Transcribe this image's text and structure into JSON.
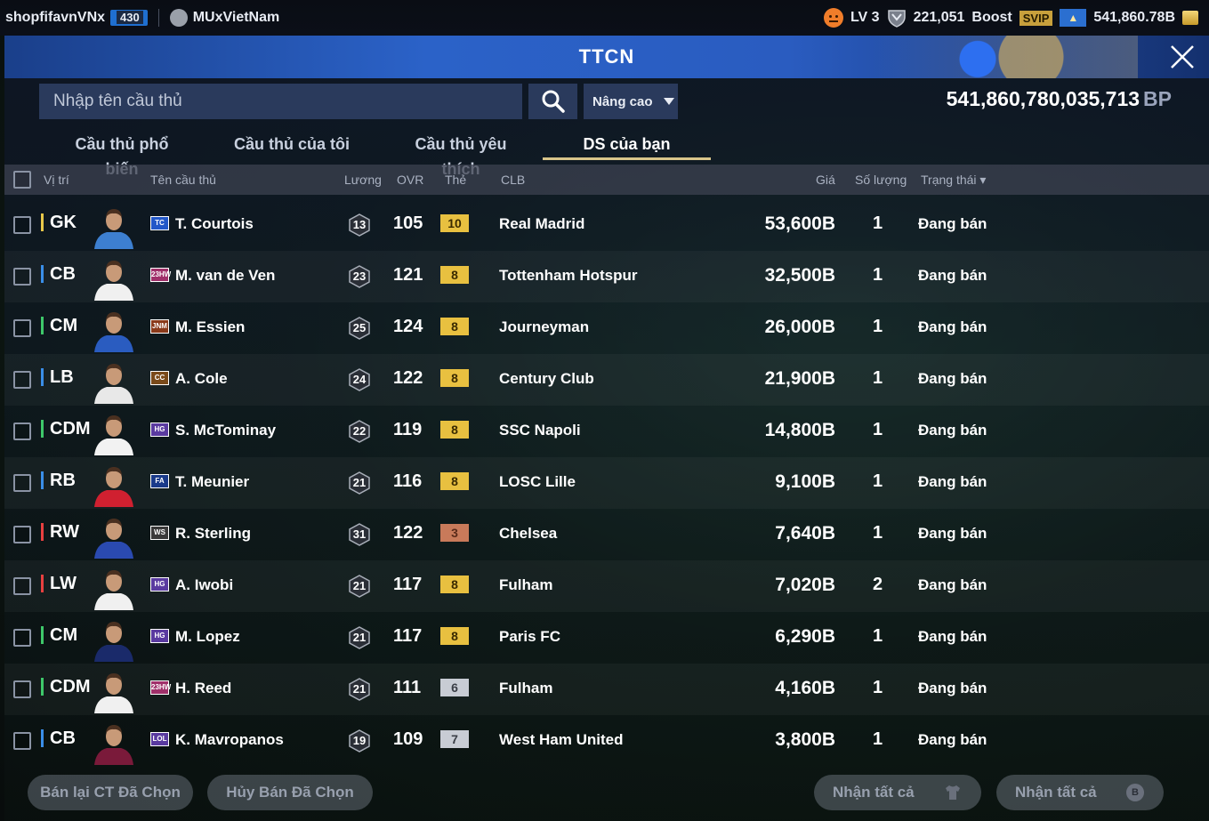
{
  "topbar": {
    "username": "shopfifavnVNx",
    "user_level": "430",
    "team_name": "MUxVietNam",
    "level_text": "LV 3",
    "shield_value": "221,051",
    "boost_label": "Boost",
    "svip_label": "SVIP",
    "coin_balance": "541,860.78B"
  },
  "window": {
    "title": "TTCN"
  },
  "search": {
    "placeholder": "Nhập tên cầu thủ",
    "advanced_label": "Nâng cao",
    "balance_value": "541,860,780,035,713",
    "balance_unit": "BP"
  },
  "tabs": [
    {
      "label": "Cầu thủ phổ biến",
      "active": false
    },
    {
      "label": "Cầu thủ của tôi",
      "active": false
    },
    {
      "label": "Cầu thủ yêu thích",
      "active": false
    },
    {
      "label": "DS của bạn",
      "active": true
    }
  ],
  "table": {
    "headers": {
      "position": "Vị trí",
      "name": "Tên cầu thủ",
      "salary": "Lương",
      "ovr": "OVR",
      "grade": "Thẻ",
      "club": "CLB",
      "price": "Giá",
      "quantity": "Số lượng",
      "status": "Trạng thái"
    },
    "rows": [
      {
        "position": "GK",
        "pos_color": "#e8c84a",
        "season": "TC",
        "season_color": "#2257c8",
        "name": "T. Courtois",
        "salary": "13",
        "ovr": "105",
        "grade": "10",
        "grade_color": "#e8c040",
        "club": "Real Madrid",
        "price": "53,600B",
        "quantity": "1",
        "status": "Đang bán",
        "kit": "#3d7fd0"
      },
      {
        "position": "CB",
        "pos_color": "#3a8ee8",
        "season": "23HW",
        "season_color": "#a0306a",
        "name": "M. van de Ven",
        "salary": "23",
        "ovr": "121",
        "grade": "8",
        "grade_color": "#e8c040",
        "club": "Tottenham Hotspur",
        "price": "32,500B",
        "quantity": "1",
        "status": "Đang bán",
        "kit": "#f0f0f0"
      },
      {
        "position": "CM",
        "pos_color": "#3ec86a",
        "season": "JNM",
        "season_color": "#8a3a1a",
        "name": "M. Essien",
        "salary": "25",
        "ovr": "124",
        "grade": "8",
        "grade_color": "#e8c040",
        "club": "Journeyman",
        "price": "26,000B",
        "quantity": "1",
        "status": "Đang bán",
        "kit": "#2a5cc0"
      },
      {
        "position": "LB",
        "pos_color": "#3a8ee8",
        "season": "CC",
        "season_color": "#7a4a1a",
        "name": "A. Cole",
        "salary": "24",
        "ovr": "122",
        "grade": "8",
        "grade_color": "#e8c040",
        "club": "Century Club",
        "price": "21,900B",
        "quantity": "1",
        "status": "Đang bán",
        "kit": "#e8e8e8"
      },
      {
        "position": "CDM",
        "pos_color": "#3ec86a",
        "season": "HG",
        "season_color": "#5a3aa0",
        "name": "S. McTominay",
        "salary": "22",
        "ovr": "119",
        "grade": "8",
        "grade_color": "#e8c040",
        "club": "SSC Napoli",
        "price": "14,800B",
        "quantity": "1",
        "status": "Đang bán",
        "kit": "#f2f2f2"
      },
      {
        "position": "RB",
        "pos_color": "#3a8ee8",
        "season": "FA",
        "season_color": "#1a3a8a",
        "name": "T. Meunier",
        "salary": "21",
        "ovr": "116",
        "grade": "8",
        "grade_color": "#e8c040",
        "club": "LOSC Lille",
        "price": "9,100B",
        "quantity": "1",
        "status": "Đang bán",
        "kit": "#d02030"
      },
      {
        "position": "RW",
        "pos_color": "#e84040",
        "season": "WS",
        "season_color": "#3a3a3a",
        "name": "R. Sterling",
        "salary": "31",
        "ovr": "122",
        "grade": "3",
        "grade_color": "#c87a5a",
        "club": "Chelsea",
        "price": "7,640B",
        "quantity": "1",
        "status": "Đang bán",
        "kit": "#2a4ab0"
      },
      {
        "position": "LW",
        "pos_color": "#e84040",
        "season": "HG",
        "season_color": "#5a3aa0",
        "name": "A. Iwobi",
        "salary": "21",
        "ovr": "117",
        "grade": "8",
        "grade_color": "#e8c040",
        "club": "Fulham",
        "price": "7,020B",
        "quantity": "2",
        "status": "Đang bán",
        "kit": "#f0f0f0"
      },
      {
        "position": "CM",
        "pos_color": "#3ec86a",
        "season": "HG",
        "season_color": "#5a3aa0",
        "name": "M. Lopez",
        "salary": "21",
        "ovr": "117",
        "grade": "8",
        "grade_color": "#e8c040",
        "club": "Paris FC",
        "price": "6,290B",
        "quantity": "1",
        "status": "Đang bán",
        "kit": "#1a2a6a"
      },
      {
        "position": "CDM",
        "pos_color": "#3ec86a",
        "season": "23HW",
        "season_color": "#a0306a",
        "name": "H. Reed",
        "salary": "21",
        "ovr": "111",
        "grade": "6",
        "grade_color": "#c8ccd4",
        "club": "Fulham",
        "price": "4,160B",
        "quantity": "1",
        "status": "Đang bán",
        "kit": "#f0f0f0"
      },
      {
        "position": "CB",
        "pos_color": "#3a8ee8",
        "season": "LOL",
        "season_color": "#5a3aa0",
        "name": "K. Mavropanos",
        "salary": "19",
        "ovr": "109",
        "grade": "7",
        "grade_color": "#c8ccd4",
        "club": "West Ham United",
        "price": "3,800B",
        "quantity": "1",
        "status": "Đang bán",
        "kit": "#7a1a3a"
      }
    ]
  },
  "footer": {
    "resell_label": "Bán lại CT Đã Chọn",
    "cancel_label": "Hủy Bán Đã Chọn",
    "claim_all_1_label": "Nhận tất cả",
    "claim_all_2_label": "Nhận tất cả",
    "claim_all_2_icon_text": "B"
  },
  "icons": {
    "search": "search-icon",
    "close": "close-icon",
    "caret": "caret-down-icon",
    "shirt": "shirt-icon",
    "coin": "coin-icon"
  }
}
